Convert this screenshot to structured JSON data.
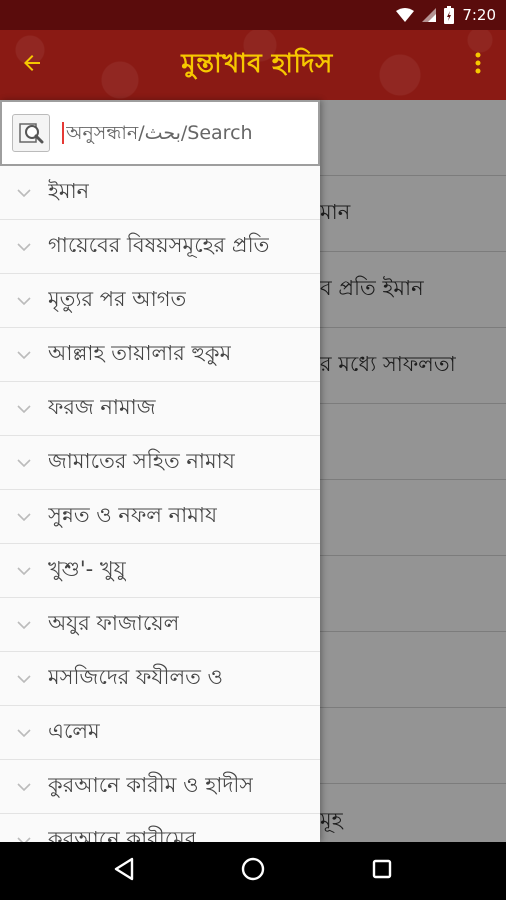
{
  "status": {
    "time": "7:20"
  },
  "app_bar": {
    "title": "মুন্তাখাব হাদিস"
  },
  "search": {
    "placeholder": "অনুসন্ধান/بحث/Search"
  },
  "drawer_items": [
    "ইমান",
    "গায়েবের বিষয়সমূহের প্রতি",
    "মৃত্যুর পর আগত",
    "আল্লাহ তায়ালার হুকুম",
    "ফরজ নামাজ",
    "জামাতের সহিত নামায",
    "সুন্নত ও নফল নামায",
    "খুশু'- খুযু",
    "অযুর ফাজায়েল",
    "মসজিদের ফযীলত ও",
    "এলেম",
    "কুরআনে কারীম ও হাদীস",
    "কুরআনে কারীমের"
  ],
  "background_rows": [
    "",
    "মান",
    "ব প্রতি ইমান",
    "র মধ্যে সাফলতা",
    "",
    "",
    "",
    "",
    "",
    "মূহ"
  ],
  "colors": {
    "app_bar": "#8a1a14",
    "status_bar": "#5a0c0c",
    "title": "#f6c800",
    "cursor": "#e53935"
  }
}
